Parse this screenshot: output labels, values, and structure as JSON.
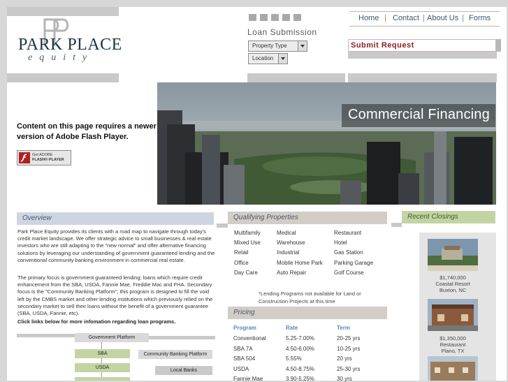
{
  "logo": {
    "monogram": "PP",
    "name": "PARK PLACE",
    "sub": "equity"
  },
  "nav": {
    "items": [
      "Home",
      "Contact",
      "About Us",
      "Forms"
    ]
  },
  "loan": {
    "title": "Loan Submission",
    "property_type": "Property Type",
    "location": "Location",
    "submit": "Submit Request"
  },
  "hero": {
    "caption": "Commercial Financing"
  },
  "flash": {
    "message": "Content on this page requires a newer version of Adobe Flash Player.",
    "badge_line1": "Get ADOBE",
    "badge_line2": "FLASH® PLAYER"
  },
  "overview": {
    "heading": "Overview",
    "p1": "Park Place Equity provides its clients with a road map to navigate through today's credit market landscape. We offer strategic advice to small businesses & real estate investors who are still adapting to the \"new normal\" and offer alternative financing solutions by leveraging our understanding of government guaranteed lending and the conventional community banking environment in commercial real estate.",
    "p2": "The primary focus is government guaranteed lending; loans which require credit enhancement from the SBA, USDA, Fannie Mae, Freddie Mac and FHA. Secondary focus is the \"Community Banking Platform\"; this program is designed to fill the void left by the CMBS market and other lending institutions which previously relied on the secondary market to sell their loans without the benefit of a government guarantee (SBA, USDA, Fannie, etc).",
    "cta": "Click links below for more infomation regarding loan programs."
  },
  "flow": {
    "government": "Government Platform",
    "community": "Community Banking Platform",
    "sba": "SBA",
    "usda": "USDA",
    "local": "Local Banks"
  },
  "qualifying": {
    "heading": "Qualifying Properties",
    "columns": [
      [
        "Multifamily",
        "Mixed Use",
        "Retail",
        "Office",
        "Day Care"
      ],
      [
        "Medical",
        "Warehouse",
        "Industrial",
        "Mobile Home Park",
        "Auto Repair"
      ],
      [
        "Restaurant",
        "Hotel",
        "Gas Station",
        "Parking Garage",
        "Golf Course"
      ]
    ],
    "note": "*Lending Programs not available for Land or Construction Projects at this time"
  },
  "pricing": {
    "heading": "Pricing",
    "headers": [
      "Program",
      "Rate",
      "Term"
    ],
    "rows": [
      [
        "Conventional",
        "5.25-7.00%",
        "20-25 yrs"
      ],
      [
        "SBA 7A",
        "4.50-6.00%",
        "10-25 yrs"
      ],
      [
        "SBA 504",
        "5.55%",
        "20 yrs"
      ],
      [
        "USDA",
        "4.50-8.75%",
        "25-30 yrs"
      ],
      [
        "Fannie Mae",
        "3.90-5.25%",
        "30 yrs"
      ]
    ]
  },
  "closings": {
    "heading": "Recent Closings",
    "items": [
      {
        "amount": "$1,740,000",
        "name": "Coastal Resort",
        "place": "Buxton, NC"
      },
      {
        "amount": "$1,350,000",
        "name": "Restaurant",
        "place": "Plano, TX"
      }
    ]
  },
  "colors": {
    "accent_green": "#c3d4a4",
    "header_gray": "#d2cdc7",
    "blue_heading": "#5a86b8",
    "submit_red": "#8b1e1e"
  }
}
